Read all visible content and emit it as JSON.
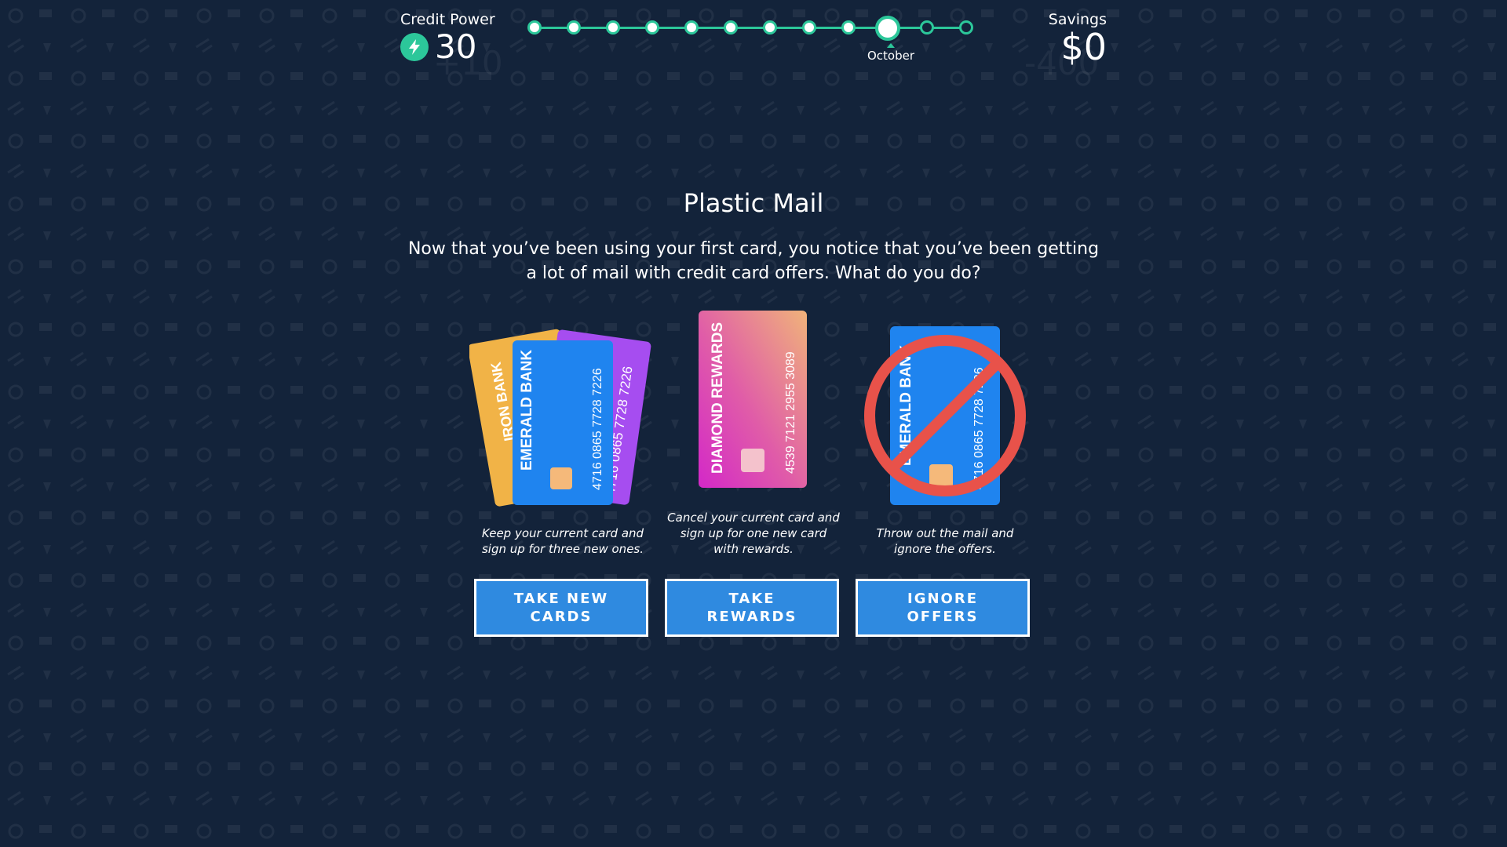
{
  "hud": {
    "credit_power_label": "Credit Power",
    "credit_power_value": "30",
    "credit_power_ghost": "+10",
    "savings_label": "Savings",
    "savings_value": "$0",
    "savings_ghost": "-400",
    "bolt_icon": "lightning-bolt-icon",
    "accent_color": "#2cc79a"
  },
  "timeline": {
    "total_steps": 12,
    "current_index": 9,
    "current_label": "October"
  },
  "scenario": {
    "title": "Plastic Mail",
    "description": "Now that you’ve been using your first card, you notice that you’ve been getting a lot of mail with credit card offers. What do you do?"
  },
  "cards": {
    "iron_bank": "IRON BANK",
    "emerald_bank": "EMERALD BANK",
    "diamond_rewards": "DIAMOND REWARDS",
    "emerald_number": "4716 0865 7728 7226",
    "purple_number": "4716 0865 7728 7226",
    "diamond_number": "4539 7121 2955 3089"
  },
  "options": [
    {
      "caption": "Keep your current card and sign up for three new ones.",
      "button": "TAKE NEW CARDS"
    },
    {
      "caption": "Cancel your current card and sign up for one new card with rewards.",
      "button": "TAKE REWARDS"
    },
    {
      "caption": "Throw out the mail and ignore the offers.",
      "button": "IGNORE OFFERS"
    }
  ],
  "colors": {
    "background": "#13233a",
    "button": "#2f8ae0",
    "prohibit": "#e8524a"
  }
}
